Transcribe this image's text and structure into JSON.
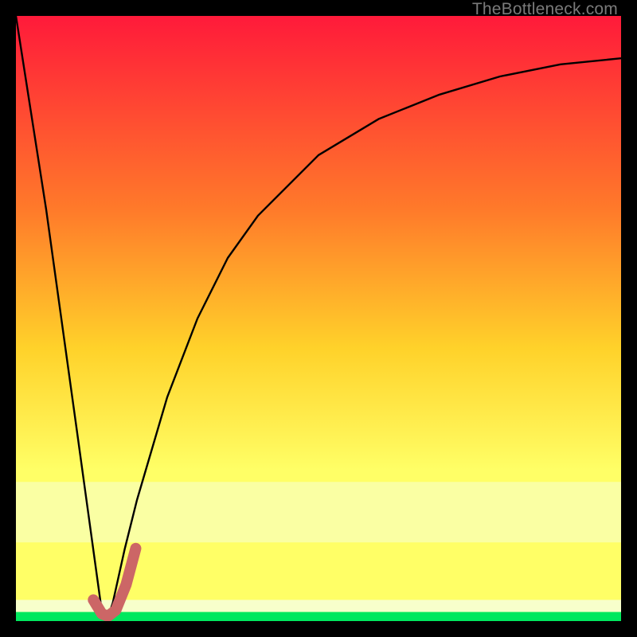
{
  "watermark": "TheBottleneck.com",
  "colors": {
    "frame": "#000000",
    "grad_top": "#ff1a3a",
    "grad_mid1": "#ff7a2a",
    "grad_mid2": "#ffd22a",
    "grad_mid3": "#ffff66",
    "grad_bottom_band": "#f6ffd6",
    "grad_green": "#00e85e",
    "curve": "#000000",
    "highlight": "#cc6666"
  },
  "chart_data": {
    "type": "line",
    "title": "",
    "xlabel": "",
    "ylabel": "",
    "xlim": [
      0,
      100
    ],
    "ylim": [
      0,
      100
    ],
    "series": [
      {
        "name": "bottleneck-curve",
        "x": [
          0,
          5,
          10,
          14,
          15,
          16,
          18,
          20,
          25,
          30,
          35,
          40,
          50,
          60,
          70,
          80,
          90,
          100
        ],
        "values": [
          100,
          68,
          32,
          3,
          0,
          3,
          12,
          20,
          37,
          50,
          60,
          67,
          77,
          83,
          87,
          90,
          92,
          93
        ]
      },
      {
        "name": "highlight-segment",
        "x": [
          12.8,
          14.2,
          15.2,
          16.5,
          18.2,
          19.8
        ],
        "values": [
          3.5,
          1.2,
          0.8,
          1.8,
          6.0,
          12.0
        ]
      }
    ],
    "optimum_x": 15
  }
}
